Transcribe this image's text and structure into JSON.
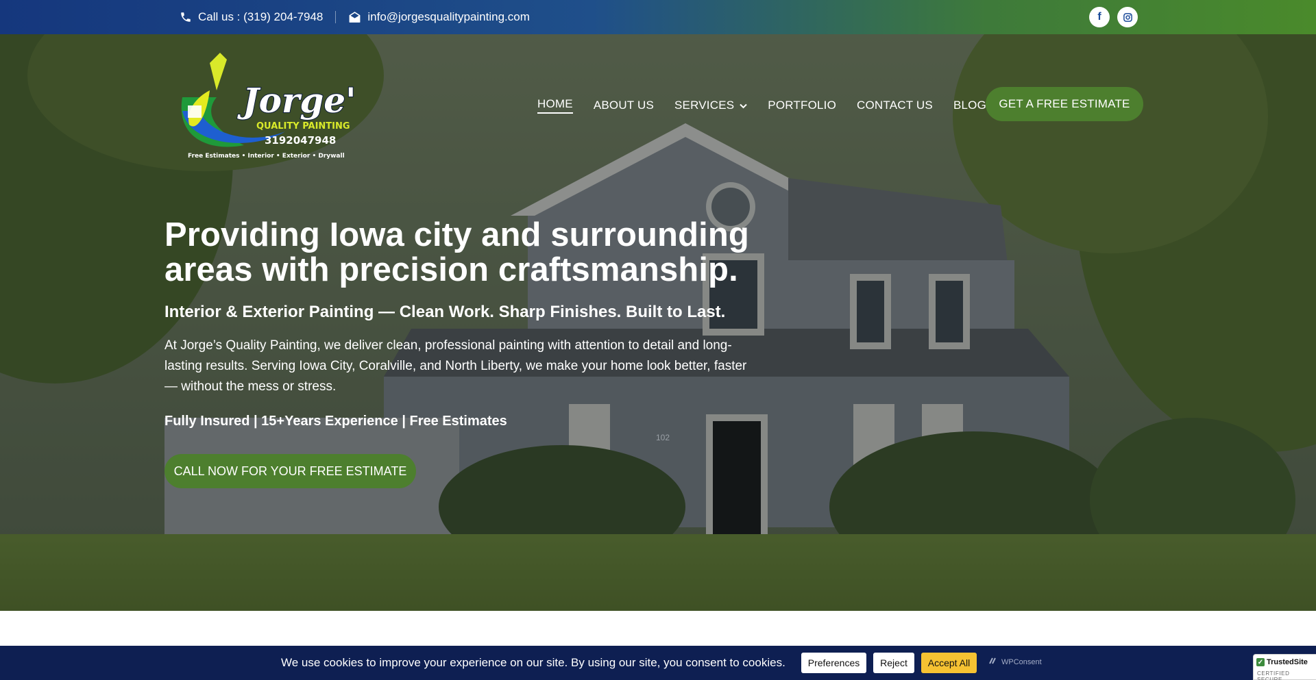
{
  "topbar": {
    "phone_label": "Call us : (319) 204-7948",
    "email_label": "info@jorgesqualitypainting.com",
    "social": [
      {
        "icon": "facebook-icon",
        "glyph": "f"
      },
      {
        "icon": "instagram-icon"
      }
    ]
  },
  "logo": {
    "brand": "Jorge's",
    "tagline": "QUALITY PAINTING",
    "phone": "3192047948",
    "services": "Free Estimates • Interior • Exterior • Drywall"
  },
  "nav": {
    "items": [
      "HOME",
      "ABOUT US",
      "SERVICES",
      "PORTFOLIO",
      "CONTACT US",
      "BLOG"
    ],
    "active": "HOME",
    "cta": "GET A FREE ESTIMATE"
  },
  "hero": {
    "headline": "Providing Iowa city and surrounding areas with precision craftsmanship.",
    "subheadline": "Interior & Exterior Painting — Clean Work. Sharp Finishes. Built to Last.",
    "paragraph": "At Jorge’s Quality Painting, we deliver clean, professional painting with attention to detail and long-lasting results. Serving Iowa City, Coralville, and North Liberty, we make your home look better, faster — without the mess or stress.",
    "features": "Fully Insured | 15+Years Experience | Free Estimates",
    "cta": "CALL NOW FOR YOUR FREE ESTIMATE",
    "house_number": "102"
  },
  "cookie": {
    "message": "We use cookies to improve your experience on our site. By using our site, you consent to cookies.",
    "preferences": "Preferences",
    "reject": "Reject",
    "accept": "Accept All",
    "brand": "WPConsent"
  },
  "trusted": {
    "title": "TrustedSite",
    "subtitle": "CERTIFIED SECURE"
  },
  "colors": {
    "accent_green": "#4d7f2e",
    "cookie_bg": "#0e1f52",
    "accept_yellow": "#f6c232"
  }
}
